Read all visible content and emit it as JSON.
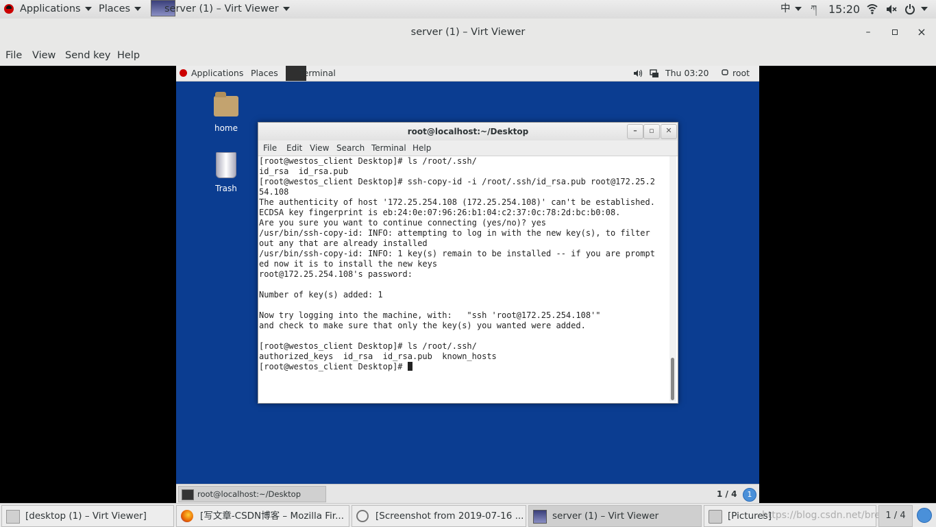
{
  "host_top_panel": {
    "applications": "Applications",
    "places": "Places",
    "active_window": "server (1) – Virt Viewer",
    "input_method": "中",
    "keyboard_layout": "ཀ",
    "clock": "15:20"
  },
  "viewer": {
    "title": "server (1) – Virt Viewer",
    "menu": [
      "File",
      "View",
      "Send key",
      "Help"
    ],
    "minimize": "–",
    "maximize": "▫",
    "close": "×"
  },
  "guest_top_panel": {
    "applications": "Applications",
    "places": "Places",
    "task": "Terminal",
    "clock": "Thu 03:20",
    "user": "root"
  },
  "desktop_icons": [
    {
      "label": "home"
    },
    {
      "label": "Trash"
    }
  ],
  "terminal": {
    "title": "root@localhost:~/Desktop",
    "menu": [
      "File",
      "Edit",
      "View",
      "Search",
      "Terminal",
      "Help"
    ],
    "lines": [
      "[root@westos_client Desktop]# ls /root/.ssh/",
      "id_rsa  id_rsa.pub",
      "[root@westos_client Desktop]# ssh-copy-id -i /root/.ssh/id_rsa.pub root@172.25.2",
      "54.108",
      "The authenticity of host '172.25.254.108 (172.25.254.108)' can't be established.",
      "ECDSA key fingerprint is eb:24:0e:07:96:26:b1:04:c2:37:0c:78:2d:bc:b0:08.",
      "Are you sure you want to continue connecting (yes/no)? yes",
      "/usr/bin/ssh-copy-id: INFO: attempting to log in with the new key(s), to filter",
      "out any that are already installed",
      "/usr/bin/ssh-copy-id: INFO: 1 key(s) remain to be installed -- if you are prompt",
      "ed now it is to install the new keys",
      "root@172.25.254.108's password:",
      "",
      "Number of key(s) added: 1",
      "",
      "Now try logging into the machine, with:   \"ssh 'root@172.25.254.108'\"",
      "and check to make sure that only the key(s) you wanted were added.",
      "",
      "[root@westos_client Desktop]# ls /root/.ssh/",
      "authorized_keys  id_rsa  id_rsa.pub  known_hosts",
      "[root@westos_client Desktop]# "
    ]
  },
  "guest_bottom_panel": {
    "task": "root@localhost:~/Desktop",
    "workspace": "1 / 4",
    "workspace_badge": "1"
  },
  "host_taskbar": {
    "tasks": [
      {
        "label": "[desktop (1) – Virt Viewer]",
        "active": false
      },
      {
        "label": "[写文章-CSDN博客 – Mozilla Fir...",
        "active": false
      },
      {
        "label": "[Screenshot from 2019-07-16 ...",
        "active": false
      },
      {
        "label": "server (1) – Virt Viewer",
        "active": true
      },
      {
        "label": "[Pictures]",
        "active": false
      }
    ],
    "watermark": "https://blog.csdn.net/bread_n",
    "workspace": "1 / 4"
  }
}
